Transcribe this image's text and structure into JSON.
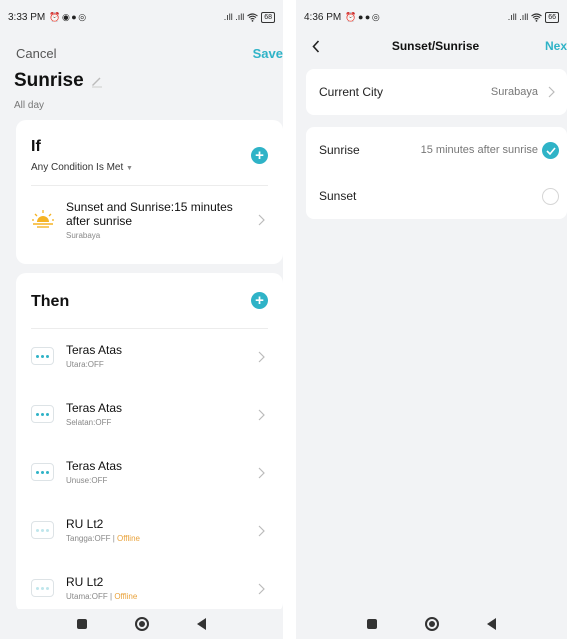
{
  "left_phone": {
    "status": {
      "time": "3:33 PM",
      "icons": "⏰ ◉ ● ◎",
      "signal": ".ıll .ıll",
      "battery": "68"
    },
    "nav": {
      "cancel": "Cancel",
      "save": "Save"
    },
    "title": "Sunrise",
    "subtitle": "All day",
    "if_card": {
      "heading": "If",
      "condition": "Any Condition Is Met",
      "item": {
        "title": "Sunset and Sunrise:15 minutes after sunrise",
        "subtitle": "Surabaya"
      }
    },
    "then_card": {
      "heading": "Then",
      "items": [
        {
          "title": "Teras Atas",
          "subtitle": "Utara:OFF",
          "offline": ""
        },
        {
          "title": "Teras Atas",
          "subtitle": "Selatan:OFF",
          "offline": ""
        },
        {
          "title": "Teras Atas",
          "subtitle": "Unuse:OFF",
          "offline": ""
        },
        {
          "title": "RU Lt2",
          "subtitle": "Tangga:OFF | ",
          "offline": "Offline"
        },
        {
          "title": "RU Lt2",
          "subtitle": "Utama:OFF | ",
          "offline": "Offline"
        }
      ]
    }
  },
  "right_phone": {
    "status": {
      "time": "4:36 PM",
      "icons": "⏰ ● ● ◎",
      "signal": ".ıll .ıll",
      "battery": "66"
    },
    "header": {
      "title": "Sunset/Sunrise",
      "next": "Nex"
    },
    "city": {
      "label": "Current City",
      "value": "Surabaya"
    },
    "options": [
      {
        "label": "Sunrise",
        "value": "15 minutes after sunrise",
        "selected": true
      },
      {
        "label": "Sunset",
        "value": "",
        "selected": false
      }
    ]
  },
  "colors": {
    "accent": "#2fb3c7",
    "offline": "#e9a23b",
    "background": "#f2f3f5"
  }
}
